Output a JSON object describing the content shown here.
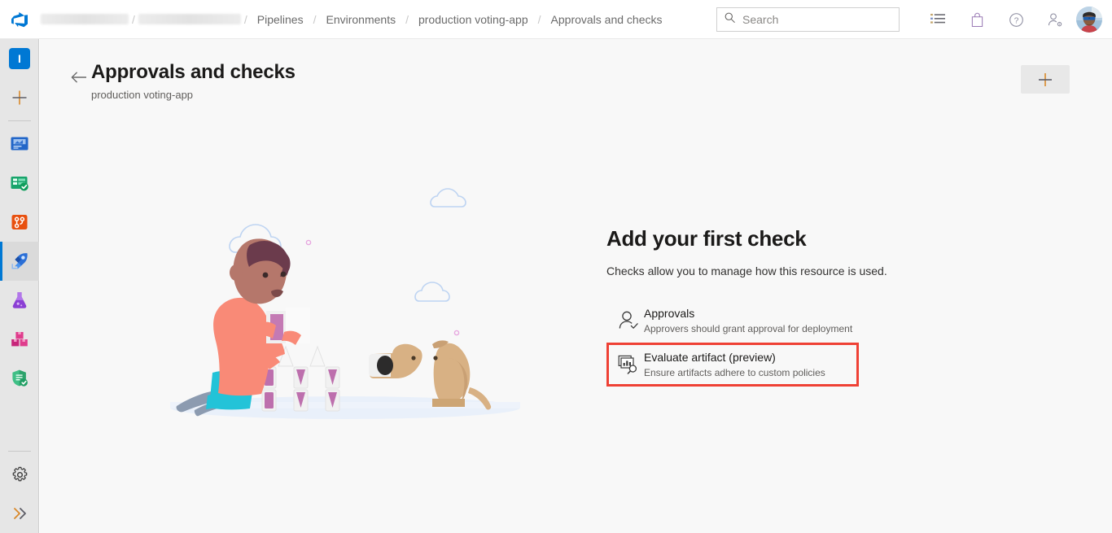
{
  "topbar": {
    "logo_icon": "azure-devops-logo",
    "breadcrumb": [
      {
        "label": "",
        "redacted": true
      },
      {
        "label": "",
        "redacted": true
      },
      {
        "label": "Pipelines",
        "redacted": false
      },
      {
        "label": "Environments",
        "redacted": false
      },
      {
        "label": "production voting-app",
        "redacted": false
      },
      {
        "label": "Approvals and checks",
        "redacted": false
      }
    ],
    "separator": "/",
    "search": {
      "placeholder": "Search",
      "value": "",
      "icon": "search-icon"
    },
    "icons": [
      {
        "name": "work-items-icon",
        "label": "Work items"
      },
      {
        "name": "marketplace-bag-icon",
        "label": "Marketplace"
      },
      {
        "name": "help-question-icon",
        "label": "Help"
      },
      {
        "name": "user-settings-icon",
        "label": "User settings"
      }
    ],
    "avatar_label": "Profile"
  },
  "rail": {
    "project_badge": "I",
    "items": [
      {
        "name": "project-avatar",
        "label": "Project",
        "selected": false
      },
      {
        "name": "add-new-item",
        "label": "New",
        "selected": false
      },
      {
        "name": "overview",
        "label": "Overview",
        "selected": false
      },
      {
        "name": "boards",
        "label": "Boards",
        "selected": false
      },
      {
        "name": "repos",
        "label": "Repos",
        "selected": false
      },
      {
        "name": "pipelines",
        "label": "Pipelines",
        "selected": true
      },
      {
        "name": "test-plans",
        "label": "Test Plans",
        "selected": false
      },
      {
        "name": "artifacts",
        "label": "Artifacts",
        "selected": false
      },
      {
        "name": "advanced-security",
        "label": "Advanced Security",
        "selected": false
      }
    ],
    "bottom": [
      {
        "name": "project-settings",
        "label": "Project settings"
      },
      {
        "name": "expand-rail",
        "label": "Expand"
      }
    ]
  },
  "page": {
    "back_label": "Back",
    "title": "Approvals and checks",
    "subtitle": "production voting-app",
    "add_button_label": "+"
  },
  "zero_data": {
    "title": "Add your first check",
    "description": "Checks allow you to manage how this resource is used.",
    "checks": [
      {
        "icon": "approvals-person-check-icon",
        "label": "Approvals",
        "description": "Approvers should grant approval for deployment",
        "highlighted": false
      },
      {
        "icon": "evaluate-artifact-icon",
        "label": "Evaluate artifact (preview)",
        "description": "Ensure artifacts adhere to custom policies",
        "highlighted": true
      }
    ]
  },
  "colors": {
    "accent": "#0078d4",
    "highlight_border": "#ef4135",
    "rail_bg": "#e6e6e6",
    "main_bg": "#f8f8f8"
  }
}
